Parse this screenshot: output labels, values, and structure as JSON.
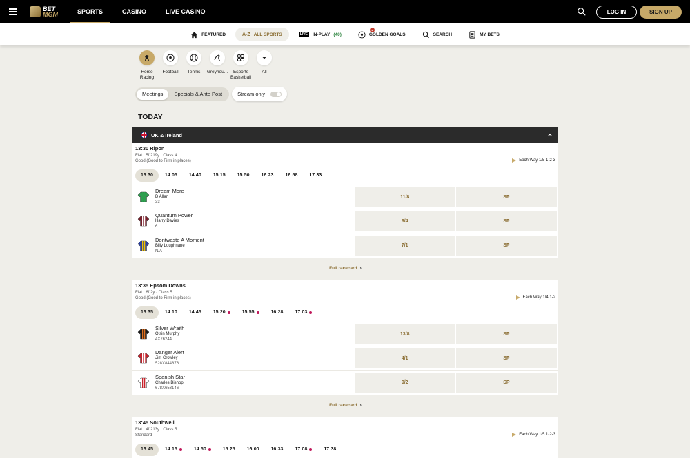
{
  "header": {
    "logo_top": "BET",
    "logo_bottom": "MGM",
    "nav": [
      "SPORTS",
      "CASINO",
      "LIVE CASINO"
    ],
    "login": "LOG IN",
    "signup": "SIGN UP"
  },
  "subnav": {
    "featured": "FEATURED",
    "az_icon": "A-Z",
    "all_sports": "ALL SPORTS",
    "live_badge": "LIVE",
    "inplay": "IN-PLAY",
    "inplay_count": "(40)",
    "golden_goals": "GOLDEN GOALS",
    "golden_badge": "●",
    "search": "SEARCH",
    "my_bets": "MY BETS"
  },
  "sports": [
    {
      "label": "Horse Racing",
      "icon": "horse-icon"
    },
    {
      "label": "Football",
      "icon": "football-icon"
    },
    {
      "label": "Tennis",
      "icon": "tennis-icon"
    },
    {
      "label": "Greyhou...",
      "icon": "greyhound-icon"
    },
    {
      "label": "Esports Basketball",
      "icon": "esports-icon"
    },
    {
      "label": "All",
      "icon": "chevron-down-icon"
    }
  ],
  "tabs": {
    "meetings": "Meetings",
    "specials": "Specials & Ante Post",
    "stream": "Stream only"
  },
  "section_title": "TODAY",
  "region": "UK & Ireland",
  "races": [
    {
      "title": "13:30 Ripon",
      "meta1": "Flat · 5f 219y · Class 4",
      "meta2": "Good (Good to Firm in places)",
      "each_way": "Each Way 1/5 1-2-3",
      "times": [
        {
          "t": "13:30",
          "live": false
        },
        {
          "t": "14:05",
          "live": false
        },
        {
          "t": "14:40",
          "live": false
        },
        {
          "t": "15:15",
          "live": false
        },
        {
          "t": "15:50",
          "live": false
        },
        {
          "t": "16:23",
          "live": false
        },
        {
          "t": "16:58",
          "live": false
        },
        {
          "t": "17:33",
          "live": false
        }
      ],
      "runners": [
        {
          "name": "Dream More",
          "jockey": "D Allan",
          "form": "33",
          "odds": "11/8",
          "sp": "SP",
          "silk": [
            "#2e9e4f",
            "#2e9e4f"
          ]
        },
        {
          "name": "Quantum Power",
          "jockey": "Harry Davies",
          "form": "6",
          "odds": "9/4",
          "sp": "SP",
          "silk": [
            "#7a1f2b",
            "#ffffff"
          ]
        },
        {
          "name": "Dontwaste A Moment",
          "jockey": "Billy Loughnane",
          "form": "N/A",
          "odds": "7/1",
          "sp": "SP",
          "silk": [
            "#2a3fa0",
            "#f2c300"
          ]
        }
      ],
      "full": "Full racecard"
    },
    {
      "title": "13:35 Epsom Downs",
      "meta1": "Flat · 6f 2y · Class 5",
      "meta2": "Good (Good to Firm in places)",
      "each_way": "Each Way 1/4 1-2",
      "times": [
        {
          "t": "13:35",
          "live": false
        },
        {
          "t": "14:10",
          "live": false
        },
        {
          "t": "14:45",
          "live": false
        },
        {
          "t": "15:20",
          "live": true
        },
        {
          "t": "15:55",
          "live": true
        },
        {
          "t": "16:28",
          "live": false
        },
        {
          "t": "17:03",
          "live": true
        }
      ],
      "runners": [
        {
          "name": "Silver Wraith",
          "jockey": "Oisin Murphy",
          "form": "4X76244",
          "odds": "13/8",
          "sp": "SP",
          "silk": [
            "#1a1a1a",
            "#e07020"
          ]
        },
        {
          "name": "Danger Alert",
          "jockey": "Jim Crowley",
          "form": "528X844876",
          "odds": "4/1",
          "sp": "SP",
          "silk": [
            "#c8202a",
            "#ffffff"
          ]
        },
        {
          "name": "Spanish Star",
          "jockey": "Charles Bishop",
          "form": "678X653146",
          "odds": "9/2",
          "sp": "SP",
          "silk": [
            "#ffffff",
            "#c8202a"
          ]
        }
      ],
      "full": "Full racecard"
    },
    {
      "title": "13:45 Southwell",
      "meta1": "Flat · 4f 213y · Class 5",
      "meta2": "Standard",
      "each_way": "Each Way 1/5 1-2-3",
      "times": [
        {
          "t": "13:45",
          "live": false
        },
        {
          "t": "14:15",
          "live": true
        },
        {
          "t": "14:50",
          "live": true
        },
        {
          "t": "15:25",
          "live": false
        },
        {
          "t": "16:00",
          "live": false
        },
        {
          "t": "16:33",
          "live": false
        },
        {
          "t": "17:08",
          "live": true
        },
        {
          "t": "17:38",
          "live": false
        }
      ],
      "runners": []
    }
  ],
  "colors": {
    "gold": "#c7a968",
    "dark": "#2b2b2b",
    "live_dot": "#c0185a"
  }
}
